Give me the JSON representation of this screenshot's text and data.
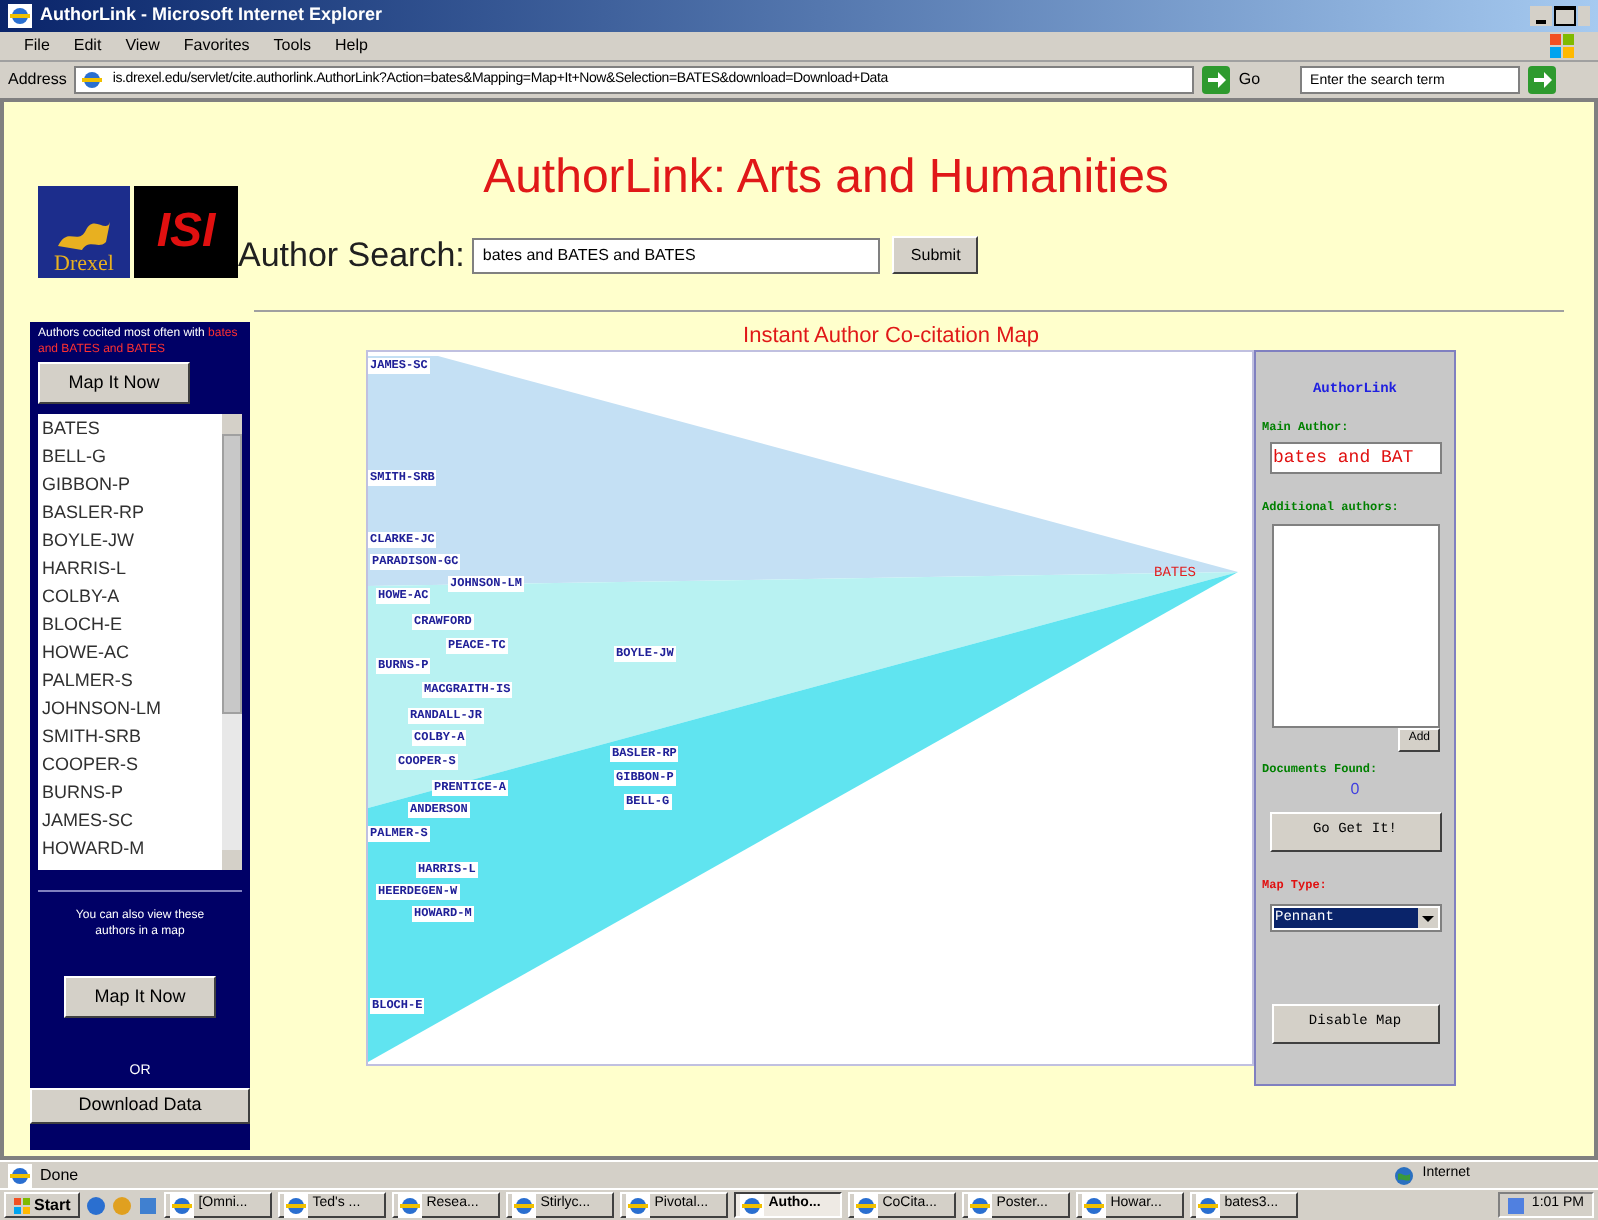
{
  "window": {
    "title": "AuthorLink - Microsoft Internet Explorer"
  },
  "menu": [
    "File",
    "Edit",
    "View",
    "Favorites",
    "Tools",
    "Help"
  ],
  "address": {
    "label": "Address",
    "value": "is.drexel.edu/servlet/cite.authorlink.AuthorLink?Action=bates&Mapping=Map+It+Now&Selection=BATES&download=Download+Data",
    "go": "Go"
  },
  "web_search": {
    "placeholder": "Enter the search term"
  },
  "header": {
    "logo_text": "Drexel",
    "isi_logo": "ISI",
    "title": "AuthorLink: Arts and Humanities",
    "search_label": "Author Search:",
    "search_value": "bates and BATES and BATES",
    "submit": "Submit"
  },
  "sidebar": {
    "intro": "Authors cocited most often with",
    "query": "bates and BATES and BATES",
    "map_button": "Map It Now",
    "authors": [
      {
        "name": "BATES",
        "selected": false
      },
      {
        "name": "BELL-G",
        "selected": false
      },
      {
        "name": "GIBBON-P",
        "selected": false
      },
      {
        "name": "BASLER-RP",
        "selected": false
      },
      {
        "name": "BOYLE-JW",
        "selected": false
      },
      {
        "name": "HARRIS-L",
        "selected": false
      },
      {
        "name": "COLBY-A",
        "selected": false
      },
      {
        "name": "BLOCH-E",
        "selected": false
      },
      {
        "name": "HOWE-AC",
        "selected": false
      },
      {
        "name": "PALMER-S",
        "selected": false
      },
      {
        "name": "JOHNSON-LM",
        "selected": false
      },
      {
        "name": "SMITH-SRB",
        "selected": false
      },
      {
        "name": "COOPER-S",
        "selected": false
      },
      {
        "name": "BURNS-P",
        "selected": false
      },
      {
        "name": "JAMES-SC",
        "selected": false
      },
      {
        "name": "HOWARD-M",
        "selected": false
      }
    ],
    "map_note": "You can also view these authors in a map",
    "map_button_2": "Map It Now",
    "or": "OR",
    "download": "Download Data"
  },
  "map": {
    "heading": "Instant Author Co-citation Map",
    "center": "BATES",
    "labels": [
      "JAMES-SC",
      "SMITH-SRB",
      "CLARKE-JC",
      "PARADISON-GC",
      "JOHNSON-LM",
      "HOWE-AC",
      "CRAWFORD",
      "PEACE-TC",
      "BOYLE-JW",
      "BURNS-P",
      "MACGRAITH-IS",
      "RANDALL-JR",
      "COLBY-A",
      "COOPER-S",
      "BASLER-RP",
      "GIBBON-P",
      "PRENTICE-A",
      "BELL-G",
      "ANDERSON",
      "PALMER-S",
      "HARRIS-L",
      "HEERDEGEN-W",
      "HOWARD-M",
      "BLOCH-E"
    ]
  },
  "panel": {
    "title": "AuthorLink",
    "main_label": "Main Author:",
    "main_value": "bates and BAT",
    "additional_label": "Additional authors:",
    "add": "Add",
    "found_label": "Documents Found:",
    "found": "0",
    "go": "Go Get It!",
    "map_type_label": "Map Type:",
    "map_type": "Pennant",
    "disable": "Disable Map"
  },
  "status_bar": {
    "text": "Done",
    "zone": "Internet"
  },
  "taskbar": {
    "start": "Start",
    "items": [
      {
        "label": "[Omni...",
        "selected": false
      },
      {
        "label": "Ted's ...",
        "selected": false
      },
      {
        "label": "Resea...",
        "selected": false
      },
      {
        "label": "Stirlyc...",
        "selected": false
      },
      {
        "label": "Pivotal...",
        "selected": false
      },
      {
        "label": "Autho...",
        "selected": true
      },
      {
        "label": "CoCita...",
        "selected": false
      },
      {
        "label": "Poster...",
        "selected": false
      },
      {
        "label": "Howar...",
        "selected": false
      },
      {
        "label": "bates3...",
        "selected": false
      }
    ],
    "clock": "1:01 PM"
  }
}
